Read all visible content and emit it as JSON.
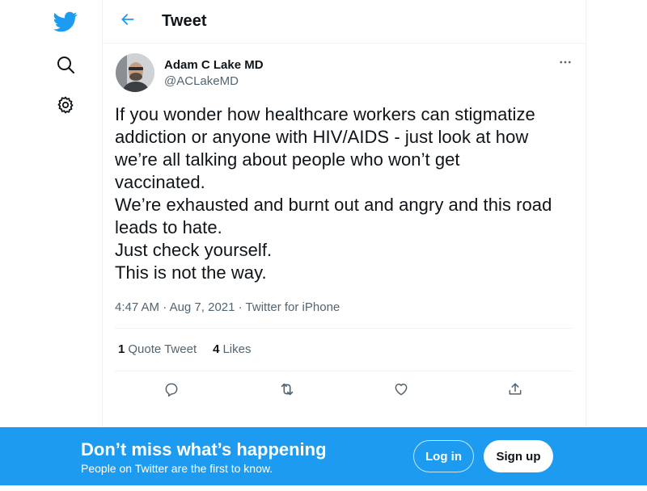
{
  "header": {
    "title": "Tweet"
  },
  "nav": {
    "icons": [
      "twitter-bird-icon",
      "search-icon",
      "gear-icon"
    ]
  },
  "tweet": {
    "display_name": "Adam C Lake MD",
    "handle": "@ACLakeMD",
    "text": "If you wonder how healthcare workers can stigmatize\naddiction or anyone with HIV/AIDS - just look at how\nwe’re all talking about people who won’t get\nvaccinated.\nWe’re exhausted and burnt out and angry and this road\nleads to hate.\nJust check yourself.\nThis is not the way.",
    "time": "4:47 AM",
    "date": "Aug 7, 2021",
    "source": "Twitter for iPhone",
    "separator": " · ",
    "stats": {
      "quote_count": "1",
      "quote_label": "Quote Tweet",
      "like_count": "4",
      "like_label": "Likes"
    }
  },
  "banner": {
    "title": "Don’t miss what’s happening",
    "subtitle": "People on Twitter are the first to know.",
    "login_label": "Log in",
    "signup_label": "Sign up"
  },
  "colors": {
    "accent": "#1d9bf0",
    "text_primary": "#0f1419",
    "text_secondary": "#536471",
    "border": "#eff3f4"
  }
}
